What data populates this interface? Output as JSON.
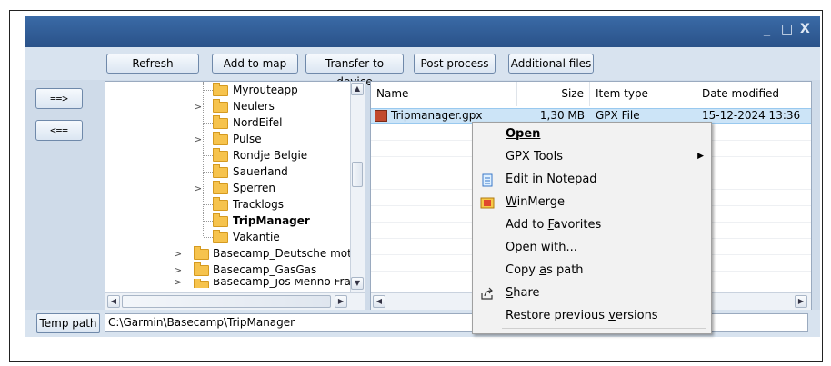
{
  "window": {
    "controls": [
      "_",
      "□",
      "X"
    ]
  },
  "toolbar": {
    "refresh": "Refresh",
    "add_to_map": "Add to map",
    "transfer_to_device": "Transfer to device",
    "post_process": "Post process",
    "additional_files": "Additional files"
  },
  "side_buttons": {
    "send_right": "==>",
    "send_left": "<=="
  },
  "tree": {
    "items": [
      {
        "label": "Myrouteapp",
        "bold": false,
        "expandable": false
      },
      {
        "label": "Neulers",
        "bold": false,
        "expandable": true
      },
      {
        "label": "NordEifel",
        "bold": false,
        "expandable": false
      },
      {
        "label": "Pulse",
        "bold": false,
        "expandable": true
      },
      {
        "label": "Rondje Belgie",
        "bold": false,
        "expandable": false
      },
      {
        "label": "Sauerland",
        "bold": false,
        "expandable": false
      },
      {
        "label": "Sperren",
        "bold": false,
        "expandable": true
      },
      {
        "label": "Tracklogs",
        "bold": false,
        "expandable": false
      },
      {
        "label": "TripManager",
        "bold": true,
        "expandable": false
      },
      {
        "label": "Vakantie",
        "bold": false,
        "expandable": false
      },
      {
        "label": "Basecamp_Deutsche motorra",
        "bold": false,
        "expandable": true
      },
      {
        "label": "Basecamp_GasGas",
        "bold": false,
        "expandable": true
      },
      {
        "label": "Basecamp_Jos Menno Frank",
        "bold": false,
        "expandable": true
      }
    ]
  },
  "filelist": {
    "columns": {
      "name": "Name",
      "size": "Size",
      "item_type": "Item type",
      "date_modified": "Date modified"
    },
    "rows": [
      {
        "name": "Tripmanager.gpx",
        "size": "1,30 MB",
        "type": "GPX File",
        "date": "15-12-2024 13:36"
      }
    ]
  },
  "context_menu": {
    "items": [
      {
        "pre": "",
        "u": "Open",
        "post": "",
        "icon": "",
        "submenu": false
      },
      {
        "pre": "GPX Tools",
        "u": "",
        "post": "",
        "icon": "",
        "submenu": true
      },
      {
        "pre": "Edit in Notepad",
        "u": "",
        "post": "",
        "icon": "notepad-icon",
        "submenu": false
      },
      {
        "pre": "",
        "u": "W",
        "post": "inMerge",
        "icon": "winmerge-icon",
        "submenu": false
      },
      {
        "pre": "Add to ",
        "u": "F",
        "post": "avorites",
        "icon": "",
        "submenu": false
      },
      {
        "pre": "Open wit",
        "u": "h",
        "post": "...",
        "icon": "",
        "submenu": false
      },
      {
        "pre": "Copy ",
        "u": "a",
        "post": "s path",
        "icon": "",
        "submenu": false
      },
      {
        "pre": "",
        "u": "S",
        "post": "hare",
        "icon": "share-icon",
        "submenu": false
      },
      {
        "pre": "Restore previous ",
        "u": "v",
        "post": "ersions",
        "icon": "",
        "submenu": false
      }
    ]
  },
  "status": {
    "temp_path_button": "Temp path",
    "path_value": "C:\\Garmin\\Basecamp\\TripManager"
  },
  "colors": {
    "titlebar": "#2f5f9c",
    "window_bg": "#cfdbe9",
    "selection": "#cce4f7",
    "folder": "#f6c34d"
  }
}
